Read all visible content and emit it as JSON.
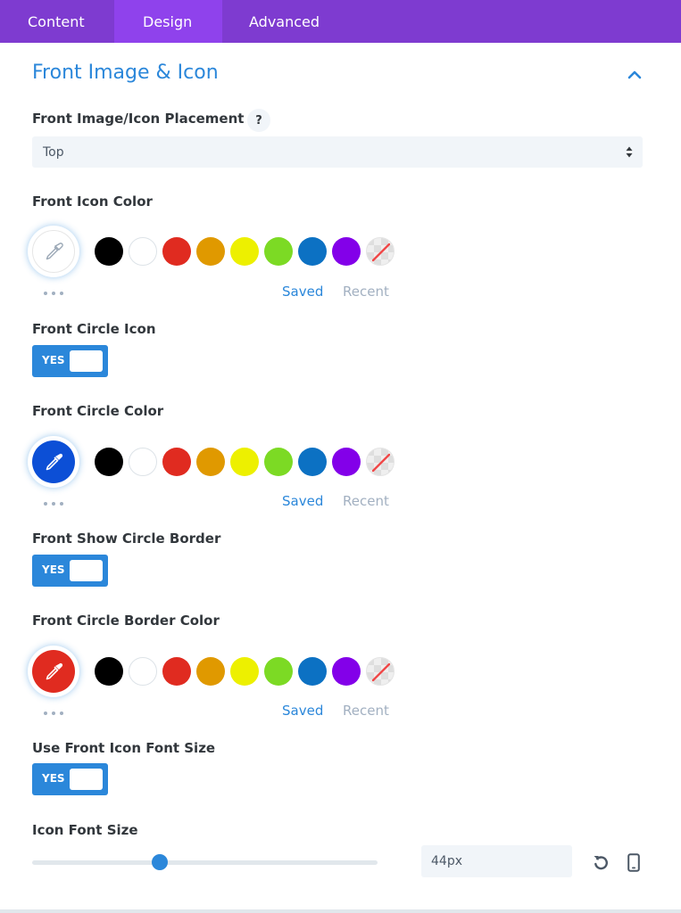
{
  "tabs": [
    {
      "label": "Content"
    },
    {
      "label": "Design"
    },
    {
      "label": "Advanced"
    }
  ],
  "section": {
    "title": "Front Image & Icon",
    "icon": "chevron-up-icon"
  },
  "placement": {
    "label": "Front Image/Icon Placement",
    "help": "?",
    "value": "Top"
  },
  "palette": {
    "swatches": [
      "#000000",
      "#ffffff",
      "#e02b20",
      "#e09900",
      "#edf000",
      "#7cda24",
      "#0c71c3",
      "#8300e9"
    ],
    "saved_label": "Saved",
    "recent_label": "Recent"
  },
  "icon_color": {
    "label": "Front Icon Color",
    "color": "#ffffff"
  },
  "circle_icon": {
    "label": "Front Circle Icon",
    "toggle": "YES"
  },
  "circle_color": {
    "label": "Front Circle Color",
    "color": "#0c4fd6"
  },
  "circle_border": {
    "label": "Front Show Circle Border",
    "toggle": "YES"
  },
  "border_color": {
    "label": "Front Circle Border Color",
    "color": "#e02b20"
  },
  "use_font_size": {
    "label": "Use Front Icon Font Size",
    "toggle": "YES"
  },
  "font_size": {
    "label": "Icon Font Size",
    "value": "44px",
    "slider_fraction": 0.37
  },
  "colors": {
    "tab_bar": "#7e3bd0",
    "tab_active": "#8f42ec",
    "accent": "#2b87da",
    "muted": "#a2b0c1"
  }
}
